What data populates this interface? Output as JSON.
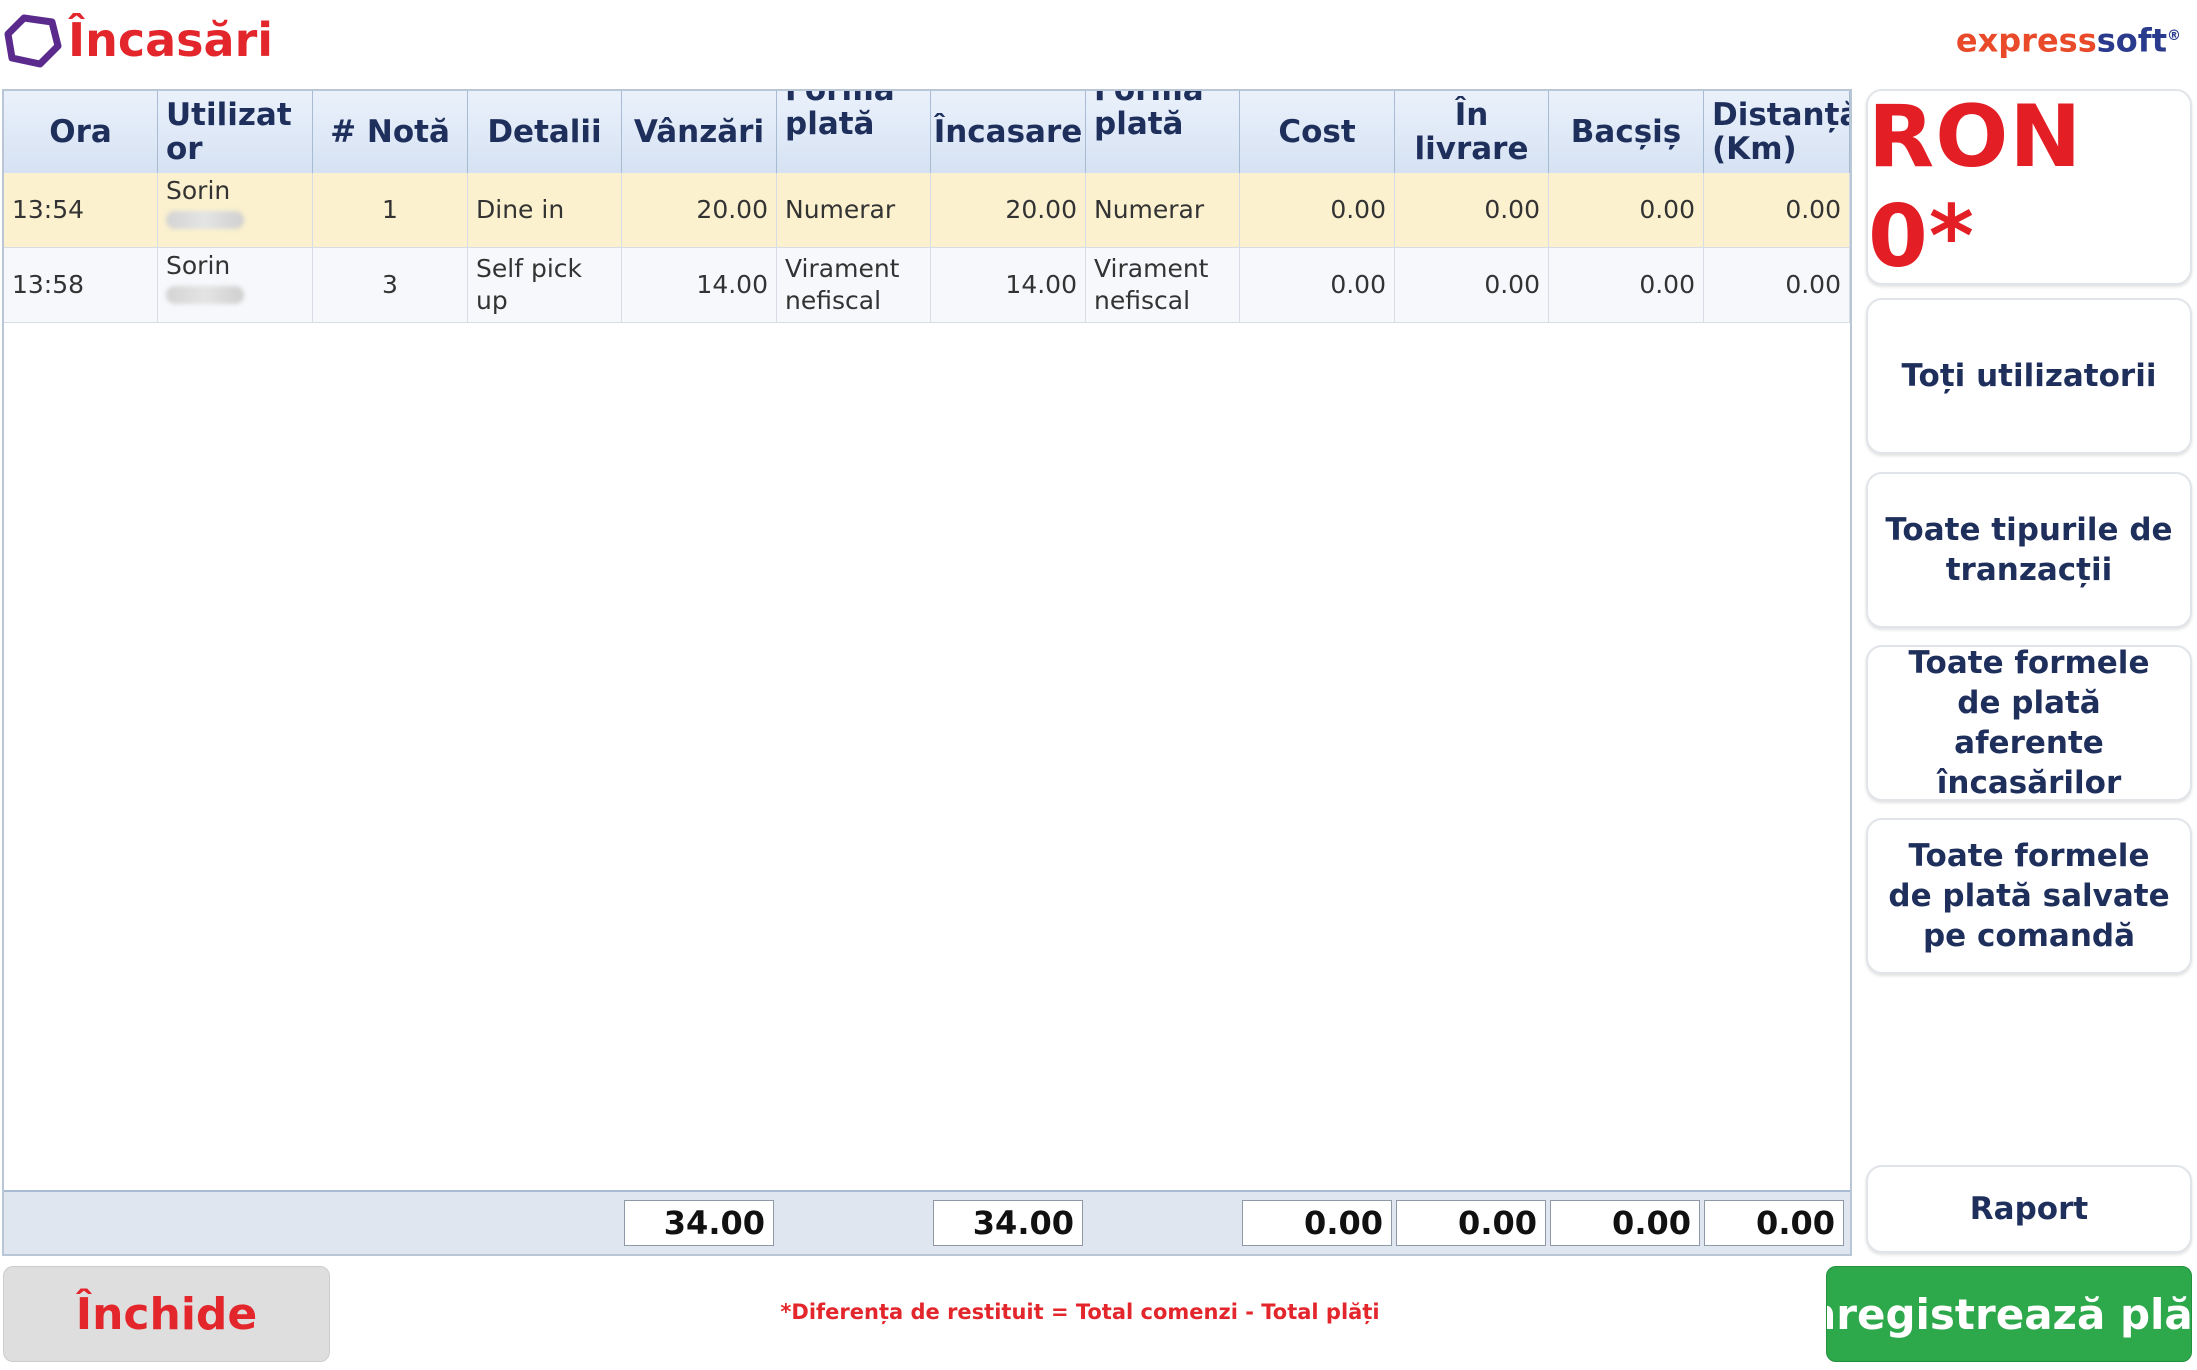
{
  "header": {
    "title": "Încasări",
    "logo_icon": "hexagon-logo-icon",
    "brand_part1": "express",
    "brand_part2": "soft",
    "brand_mark": "®"
  },
  "table": {
    "columns": {
      "ora": "Ora",
      "utilizator": "Utilizator",
      "nota": "# Notă",
      "detalii": "Detalii",
      "vanzari": "Vânzări",
      "forma_plata_1": "Forma plată",
      "incasare": "Încasare",
      "forma_plata_2": "Forma plată",
      "cost": "Cost",
      "in_livrare": "În livrare",
      "bacsis": "Bacșiș",
      "distanta": "Distanță (Km)"
    },
    "rows": [
      {
        "ora": "13:54",
        "utilizator": "Sorin",
        "nota": "1",
        "detalii": "Dine in",
        "vanzari": "20.00",
        "forma_plata_1": "Numerar",
        "incasare": "20.00",
        "forma_plata_2": "Numerar",
        "cost": "0.00",
        "in_livrare": "0.00",
        "bacsis": "0.00",
        "distanta": "0.00"
      },
      {
        "ora": "13:58",
        "utilizator": "Sorin",
        "nota": "3",
        "detalii": "Self pick up",
        "vanzari": "14.00",
        "forma_plata_1": "Virament nefiscal",
        "incasare": "14.00",
        "forma_plata_2": "Virament nefiscal",
        "cost": "0.00",
        "in_livrare": "0.00",
        "bacsis": "0.00",
        "distanta": "0.00"
      }
    ],
    "totals": {
      "vanzari": "34.00",
      "incasare": "34.00",
      "cost": "0.00",
      "in_livrare": "0.00",
      "bacsis": "0.00",
      "distanta": "0.00"
    }
  },
  "sidebar": {
    "balance": "RON 0*",
    "filter_users": "Toți utilizatorii",
    "filter_transactions": "Toate tipurile de tranzacții",
    "filter_payment_forms": "Toate formele de plată aferente încasărilor",
    "filter_saved_payment_forms": "Toate formele de plată salvate pe comandă",
    "report": "Raport"
  },
  "footer": {
    "close": "Închide",
    "note": "*Diferența de restituit = Total comenzi - Total plăți",
    "save_payments": "Înregistrează plăți"
  },
  "colors": {
    "accent_red": "#e3262b",
    "header_blue": "#1f2f5c",
    "selected_row": "#fbf1cf",
    "save_green": "#2da84a"
  }
}
